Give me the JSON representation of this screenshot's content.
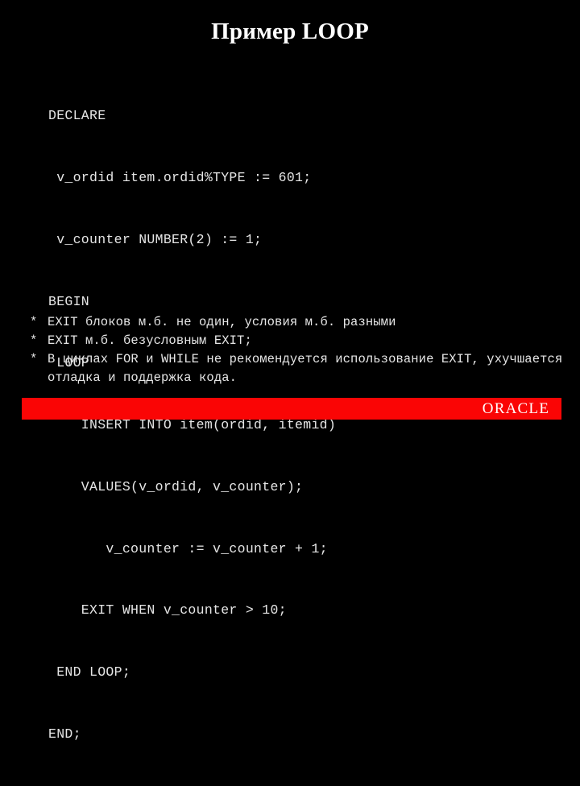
{
  "slide": {
    "title": "Пример LOOP",
    "background_color": "#000000",
    "text_color": "#e6e6e6"
  },
  "code": {
    "language": "PL/SQL",
    "lines": [
      "DECLARE",
      " v_ordid item.ordid%TYPE := 601;",
      " v_counter NUMBER(2) := 1;",
      "BEGIN",
      " LOOP",
      "    INSERT INTO item(ordid, itemid)",
      "    VALUES(v_ordid, v_counter);",
      "       v_counter := v_counter + 1;",
      "    EXIT WHEN v_counter > 10;",
      " END LOOP;",
      "END;"
    ]
  },
  "notes": {
    "bullet_mark": "*",
    "items": [
      "EXIT блоков м.б. не один, условия м.б. разными",
      "EXIT м.б. безусловным EXIT;",
      "В циклах FOR и WHILE не рекомендуется использование EXIT, ухучшается отладка и поддержка кода."
    ]
  },
  "footer": {
    "logo_text": "ORACLE",
    "bar_color": "#fa0505",
    "logo_color": "#ffffff"
  }
}
